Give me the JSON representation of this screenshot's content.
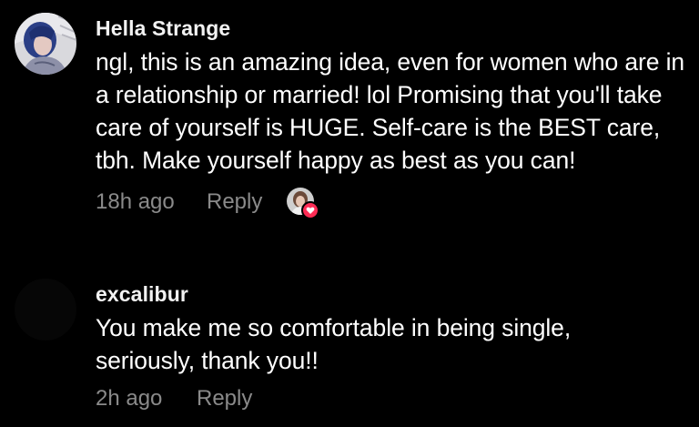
{
  "comments": [
    {
      "username": "Hella Strange",
      "text": "ngl, this is an amazing idea, even for women who are in a relationship or married! lol Promising that you'll take care of yourself is HUGE. Self-care is the BEST care, tbh. Make yourself happy as best as you can!",
      "time": "18h ago",
      "reply_label": "Reply",
      "liked_by_creator": true,
      "avatar_icon": "user-avatar-photo"
    },
    {
      "username": "excalibur",
      "text": "You make me so comfortable in being single, seriously, thank you!!",
      "time": "2h ago",
      "reply_label": "Reply",
      "liked_by_creator": false,
      "avatar_icon": "user-avatar-black"
    }
  ],
  "colors": {
    "background": "#000000",
    "text": "#ffffff",
    "meta": "#8a8a8a",
    "heart_badge": "#fe2c55"
  }
}
